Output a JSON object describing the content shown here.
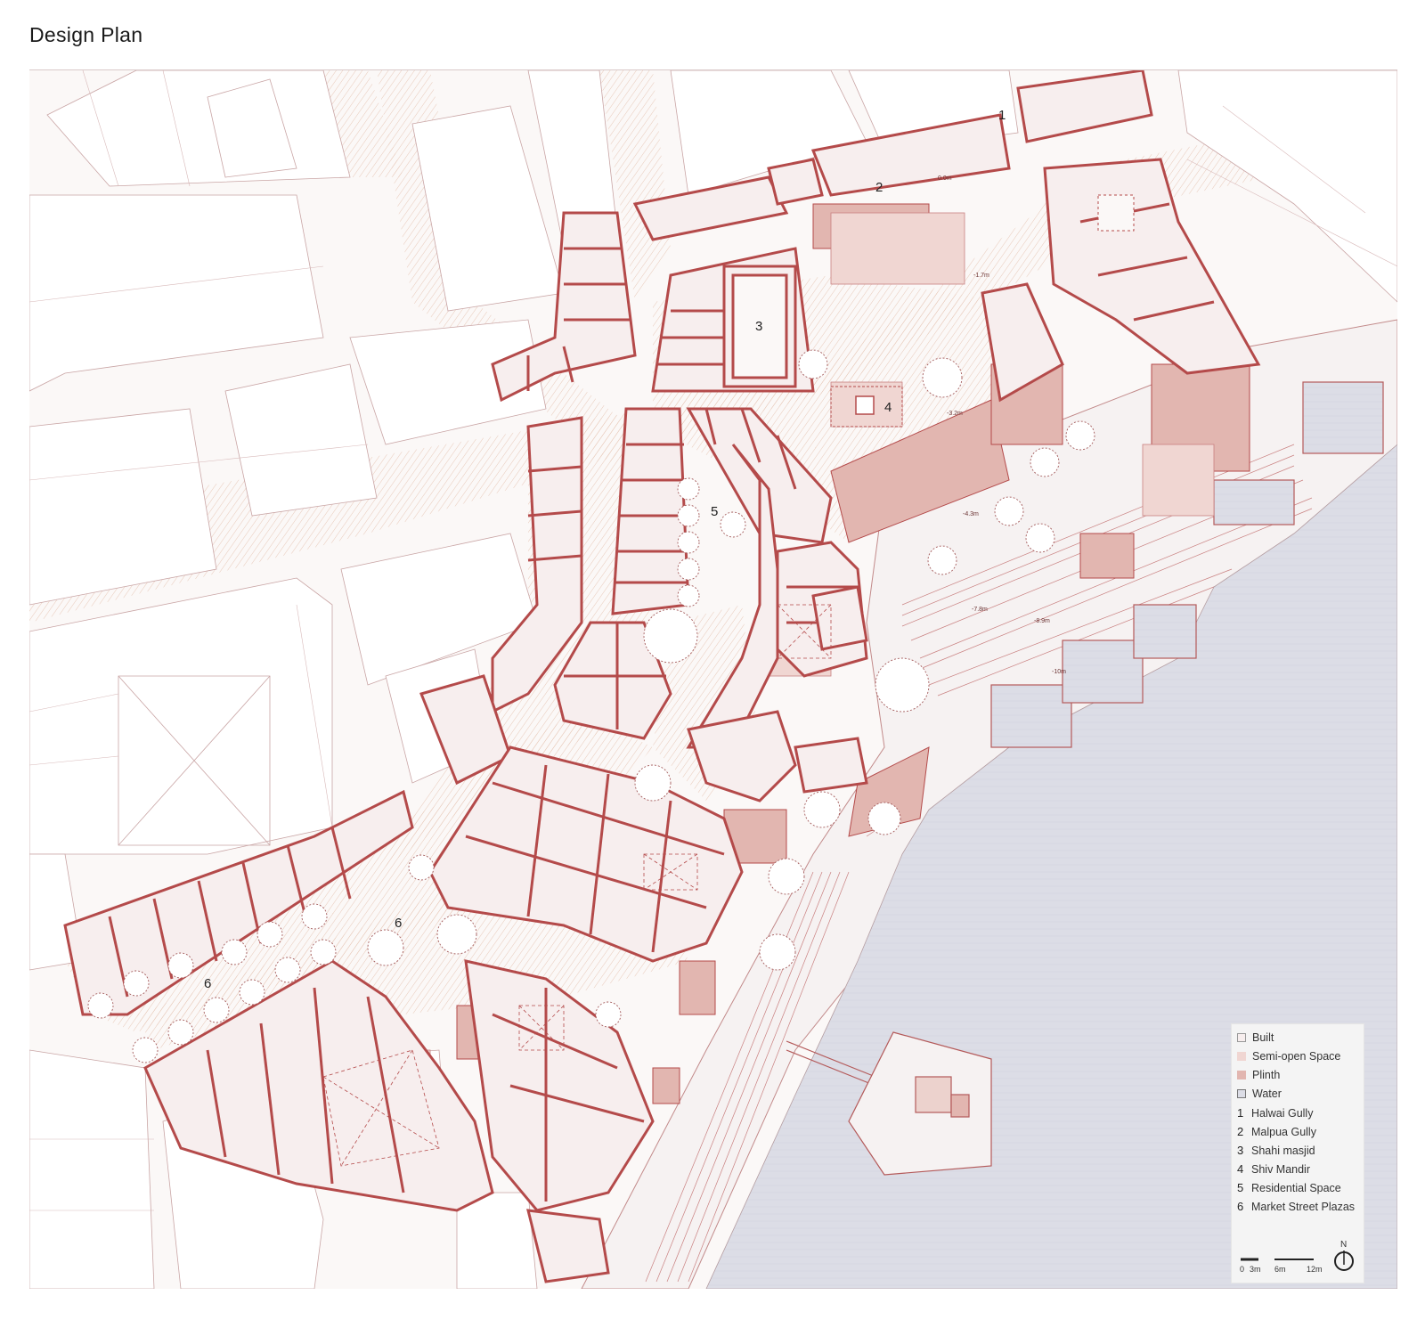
{
  "title": "Design Plan",
  "colors": {
    "line": "#b44a4a",
    "built_fill": "#f7eeee",
    "semi_open": "#f0d6d2",
    "plinth": "#e2b6b0",
    "water": "#dcdde6",
    "street": "#f6ead8",
    "ground": "#fbf8f7"
  },
  "plan_labels": {
    "l1": "1",
    "l2": "2",
    "l3": "3",
    "l4": "4",
    "l5": "5",
    "l6a": "6",
    "l6b": "6"
  },
  "levels": {
    "lv0": "0.0m",
    "lv1": "-1.7m",
    "lv2": "-3.2m",
    "lv3": "-4.3m",
    "lv4": "-7.8m",
    "lv5": "-8.9m",
    "lv6": "-10m"
  },
  "legend": {
    "swatches": [
      {
        "label": "Built"
      },
      {
        "label": "Semi-open Space"
      },
      {
        "label": "Plinth"
      },
      {
        "label": "Water"
      }
    ],
    "items": [
      {
        "num": "1",
        "label": "Halwai Gully"
      },
      {
        "num": "2",
        "label": "Malpua Gully"
      },
      {
        "num": "3",
        "label": "Shahi masjid"
      },
      {
        "num": "4",
        "label": "Shiv Mandir"
      },
      {
        "num": "5",
        "label": "Residential Space"
      },
      {
        "num": "6",
        "label": "Market Street Plazas"
      }
    ]
  },
  "scale": {
    "s0": "0",
    "s1": "3m",
    "s2": "6m",
    "s3": "12m"
  },
  "north": "N"
}
